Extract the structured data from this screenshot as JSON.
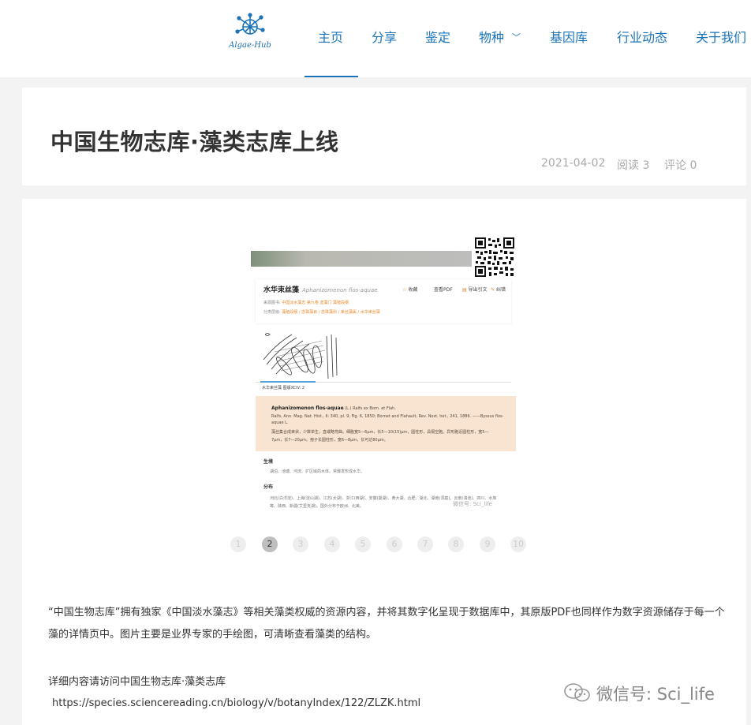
{
  "brand": {
    "logo_text": "Algae-Hub",
    "color": "#1a73b8"
  },
  "nav": {
    "items": [
      {
        "label": "主页",
        "active": true
      },
      {
        "label": "分享"
      },
      {
        "label": "鉴定"
      },
      {
        "label": "物种",
        "has_dropdown": true
      },
      {
        "label": "基因库"
      },
      {
        "label": "行业动态"
      },
      {
        "label": "关于我们"
      }
    ]
  },
  "article": {
    "title": "中国生物志库·藻类志库上线",
    "date": "2021-04-02",
    "reads": "阅读 3",
    "comments": "评论 0"
  },
  "embedded_screenshot": {
    "species_name": "水华束丝藻",
    "species_latin": "Aphanizomenon flos-aquae",
    "tools": [
      "收藏",
      "查看PDF",
      "导出引文",
      "纠错"
    ],
    "source_label": "来源图书:",
    "source_value": "中国淡水藻志 第九卷 蓝藻门 藻殖段纲",
    "class_label": "分类层级:",
    "class_value": "藻殖段纲 / 念珠藻目 / 念珠藻科 / 束丝藻属 / 水华束丝藻",
    "tab_label": "水华束丝藻 图版XCIV: 2",
    "desc_latin": "Aphanizomenon flos-aquae",
    "desc_author": "(L.) Ralfs ex Born. et Flah.",
    "desc_ref": "Ralfs, Ann. Mag. Nat. Hist., II: 340, pl. 9, Fig. 6, 1850; Bornet and Flahault, Rev. Nost. het., 241, 1886. ——Byssus flos-",
    "desc_ref2": "aquae L.",
    "desc_cn": "藻丝集合成束状，少数单生，直或略弯曲。细胞宽5—6μm，长5—10(15)μm，圆柱形，具假空胞。异形胞近圆柱形，宽5—",
    "desc_cn2": "7μm，长7—20μm。孢子长圆柱形，宽6—8μm，长可达80μm。",
    "habitat_title": "生境",
    "habitat_text": "湖泊、池塘、河流、扩区域的水体。常爆发形成水华。",
    "distribution_title": "分布",
    "distribution_text": "河北(白洋淀)、上海(淀山湖)、江苏(太湖)、浙江(西湖)、安徽(巢湖)、黄大湖、合肥、湖北、湖南(洞庭)、云南(滇池)、四川、水库",
    "distribution_text2": "等、陕西、新疆(艾里克湖)。国外分布于欧洲、北美。",
    "watermark": "微信号: Sci_life"
  },
  "pagination": {
    "pages": [
      "1",
      "2",
      "3",
      "4",
      "5",
      "6",
      "7",
      "8",
      "9",
      "10"
    ],
    "current": "2"
  },
  "body": {
    "paragraph": "“中国生物志库”拥有独家《中国淡水藻志》等相关藻类权威的资源内容，并将其数字化呈现于数据库中，其原版PDF也同样作为数字资源储存于每一个藻的详情页中。图片主要是业界专家的手绘图，可清晰查看藻类的结构。",
    "visit_text": "详细内容请访问中国生物志库·藻类志库",
    "url": "https://species.sciencereading.cn/biology/v/botanyIndex/122/ZLZK.html"
  },
  "watermark": {
    "text": "微信号: Sci_life"
  }
}
